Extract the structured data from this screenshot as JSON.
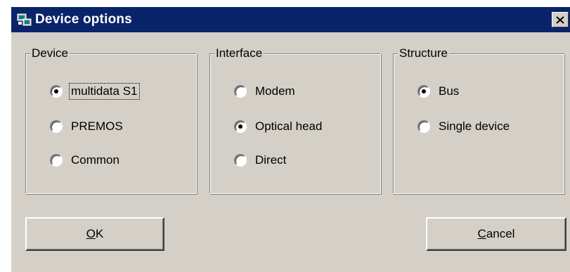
{
  "window": {
    "title": "Device options",
    "icon": "device-app-icon",
    "close_icon": "close-icon"
  },
  "groups": {
    "device": {
      "legend": "Device",
      "options": [
        {
          "label": "multidata S1",
          "selected": true,
          "focused": true
        },
        {
          "label": "PREMOS",
          "selected": false
        },
        {
          "label": "Common",
          "selected": false
        }
      ]
    },
    "interface": {
      "legend": "Interface",
      "options": [
        {
          "label": "Modem",
          "selected": false
        },
        {
          "label": "Optical head",
          "selected": true
        },
        {
          "label": "Direct",
          "selected": false
        }
      ]
    },
    "structure": {
      "legend": "Structure",
      "options": [
        {
          "label": "Bus",
          "selected": true
        },
        {
          "label": "Single device",
          "selected": false
        }
      ]
    }
  },
  "buttons": {
    "ok": {
      "mnemonic": "O",
      "rest": "K"
    },
    "cancel": {
      "mnemonic": "C",
      "rest": "ancel"
    }
  },
  "colors": {
    "titlebar": "#0a246a",
    "face": "#d4d0c8"
  }
}
